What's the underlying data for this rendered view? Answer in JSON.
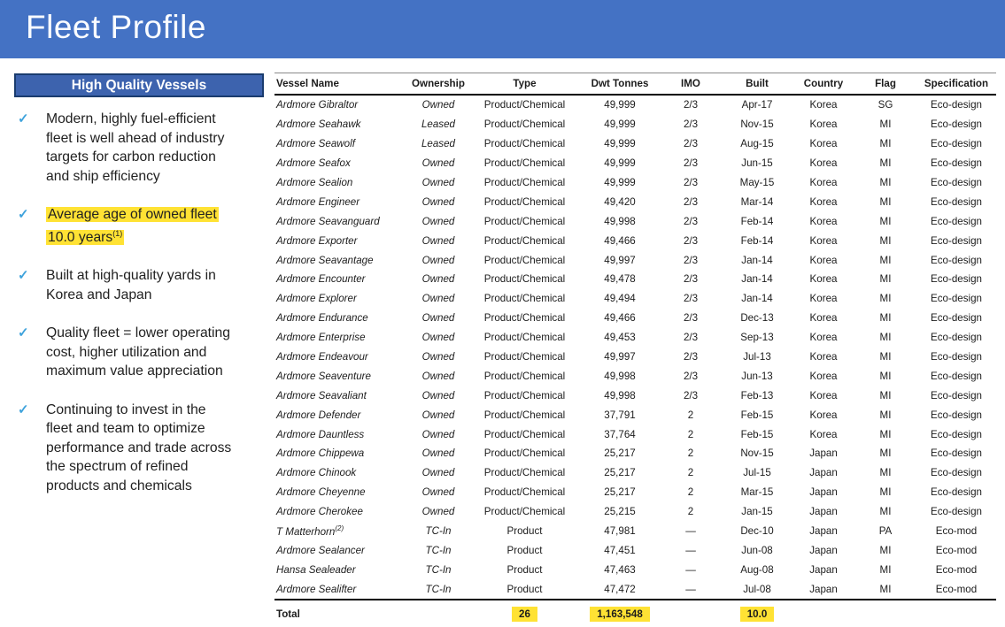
{
  "slide": {
    "title": "Fleet Profile"
  },
  "colors": {
    "title_bar_blue": "#4472C4",
    "panel_blue": "#3D63AE",
    "panel_border_navy": "#1A3C6E",
    "check_blue": "#3FA3DC",
    "highlight_yellow": "#FFE234"
  },
  "sidebar": {
    "header": "High Quality Vessels",
    "check_icon": "✓",
    "bullets": [
      {
        "lines": [
          "Modern, highly fuel-efficient",
          "fleet is well ahead of industry",
          "targets for carbon reduction",
          "and ship efficiency"
        ],
        "highlight": false,
        "sup": ""
      },
      {
        "lines": [
          "Average age of owned fleet",
          "10.0 years"
        ],
        "highlight": true,
        "sup": "(1)"
      },
      {
        "lines": [
          "Built at high-quality yards in",
          "Korea and Japan"
        ],
        "highlight": false,
        "sup": ""
      },
      {
        "lines": [
          "Quality fleet = lower operating",
          "cost, higher utilization and",
          "maximum value appreciation"
        ],
        "highlight": false,
        "sup": ""
      },
      {
        "lines": [
          "Continuing to invest in the",
          "fleet and team to optimize",
          "performance and trade across",
          "the spectrum of refined",
          "products and chemicals"
        ],
        "highlight": false,
        "sup": ""
      }
    ]
  },
  "table": {
    "columns": [
      "Vessel Name",
      "Ownership",
      "Type",
      "Dwt Tonnes",
      "IMO",
      "Built",
      "Country",
      "Flag",
      "Specification"
    ],
    "rows": [
      {
        "name": "Ardmore Gibraltor",
        "sup": "",
        "ownership": "Owned",
        "type": "Product/Chemical",
        "dwt": "49,999",
        "imo": "2/3",
        "built": "Apr-17",
        "country": "Korea",
        "flag": "SG",
        "spec": "Eco-design"
      },
      {
        "name": "Ardmore Seahawk",
        "sup": "",
        "ownership": "Leased",
        "type": "Product/Chemical",
        "dwt": "49,999",
        "imo": "2/3",
        "built": "Nov-15",
        "country": "Korea",
        "flag": "MI",
        "spec": "Eco-design"
      },
      {
        "name": "Ardmore Seawolf",
        "sup": "",
        "ownership": "Leased",
        "type": "Product/Chemical",
        "dwt": "49,999",
        "imo": "2/3",
        "built": "Aug-15",
        "country": "Korea",
        "flag": "MI",
        "spec": "Eco-design"
      },
      {
        "name": "Ardmore Seafox",
        "sup": "",
        "ownership": "Owned",
        "type": "Product/Chemical",
        "dwt": "49,999",
        "imo": "2/3",
        "built": "Jun-15",
        "country": "Korea",
        "flag": "MI",
        "spec": "Eco-design"
      },
      {
        "name": "Ardmore Sealion",
        "sup": "",
        "ownership": "Owned",
        "type": "Product/Chemical",
        "dwt": "49,999",
        "imo": "2/3",
        "built": "May-15",
        "country": "Korea",
        "flag": "MI",
        "spec": "Eco-design"
      },
      {
        "name": "Ardmore Engineer",
        "sup": "",
        "ownership": "Owned",
        "type": "Product/Chemical",
        "dwt": "49,420",
        "imo": "2/3",
        "built": "Mar-14",
        "country": "Korea",
        "flag": "MI",
        "spec": "Eco-design"
      },
      {
        "name": "Ardmore Seavanguard",
        "sup": "",
        "ownership": "Owned",
        "type": "Product/Chemical",
        "dwt": "49,998",
        "imo": "2/3",
        "built": "Feb-14",
        "country": "Korea",
        "flag": "MI",
        "spec": "Eco-design"
      },
      {
        "name": "Ardmore Exporter",
        "sup": "",
        "ownership": "Owned",
        "type": "Product/Chemical",
        "dwt": "49,466",
        "imo": "2/3",
        "built": "Feb-14",
        "country": "Korea",
        "flag": "MI",
        "spec": "Eco-design"
      },
      {
        "name": "Ardmore Seavantage",
        "sup": "",
        "ownership": "Owned",
        "type": "Product/Chemical",
        "dwt": "49,997",
        "imo": "2/3",
        "built": "Jan-14",
        "country": "Korea",
        "flag": "MI",
        "spec": "Eco-design"
      },
      {
        "name": "Ardmore Encounter",
        "sup": "",
        "ownership": "Owned",
        "type": "Product/Chemical",
        "dwt": "49,478",
        "imo": "2/3",
        "built": "Jan-14",
        "country": "Korea",
        "flag": "MI",
        "spec": "Eco-design"
      },
      {
        "name": "Ardmore Explorer",
        "sup": "",
        "ownership": "Owned",
        "type": "Product/Chemical",
        "dwt": "49,494",
        "imo": "2/3",
        "built": "Jan-14",
        "country": "Korea",
        "flag": "MI",
        "spec": "Eco-design"
      },
      {
        "name": "Ardmore Endurance",
        "sup": "",
        "ownership": "Owned",
        "type": "Product/Chemical",
        "dwt": "49,466",
        "imo": "2/3",
        "built": "Dec-13",
        "country": "Korea",
        "flag": "MI",
        "spec": "Eco-design"
      },
      {
        "name": "Ardmore Enterprise",
        "sup": "",
        "ownership": "Owned",
        "type": "Product/Chemical",
        "dwt": "49,453",
        "imo": "2/3",
        "built": "Sep-13",
        "country": "Korea",
        "flag": "MI",
        "spec": "Eco-design"
      },
      {
        "name": "Ardmore Endeavour",
        "sup": "",
        "ownership": "Owned",
        "type": "Product/Chemical",
        "dwt": "49,997",
        "imo": "2/3",
        "built": "Jul-13",
        "country": "Korea",
        "flag": "MI",
        "spec": "Eco-design"
      },
      {
        "name": "Ardmore Seaventure",
        "sup": "",
        "ownership": "Owned",
        "type": "Product/Chemical",
        "dwt": "49,998",
        "imo": "2/3",
        "built": "Jun-13",
        "country": "Korea",
        "flag": "MI",
        "spec": "Eco-design"
      },
      {
        "name": "Ardmore Seavaliant",
        "sup": "",
        "ownership": "Owned",
        "type": "Product/Chemical",
        "dwt": "49,998",
        "imo": "2/3",
        "built": "Feb-13",
        "country": "Korea",
        "flag": "MI",
        "spec": "Eco-design"
      },
      {
        "name": "Ardmore Defender",
        "sup": "",
        "ownership": "Owned",
        "type": "Product/Chemical",
        "dwt": "37,791",
        "imo": "2",
        "built": "Feb-15",
        "country": "Korea",
        "flag": "MI",
        "spec": "Eco-design"
      },
      {
        "name": "Ardmore Dauntless",
        "sup": "",
        "ownership": "Owned",
        "type": "Product/Chemical",
        "dwt": "37,764",
        "imo": "2",
        "built": "Feb-15",
        "country": "Korea",
        "flag": "MI",
        "spec": "Eco-design"
      },
      {
        "name": "Ardmore Chippewa",
        "sup": "",
        "ownership": "Owned",
        "type": "Product/Chemical",
        "dwt": "25,217",
        "imo": "2",
        "built": "Nov-15",
        "country": "Japan",
        "flag": "MI",
        "spec": "Eco-design"
      },
      {
        "name": "Ardmore Chinook",
        "sup": "",
        "ownership": "Owned",
        "type": "Product/Chemical",
        "dwt": "25,217",
        "imo": "2",
        "built": "Jul-15",
        "country": "Japan",
        "flag": "MI",
        "spec": "Eco-design"
      },
      {
        "name": "Ardmore Cheyenne",
        "sup": "",
        "ownership": "Owned",
        "type": "Product/Chemical",
        "dwt": "25,217",
        "imo": "2",
        "built": "Mar-15",
        "country": "Japan",
        "flag": "MI",
        "spec": "Eco-design"
      },
      {
        "name": "Ardmore Cherokee",
        "sup": "",
        "ownership": "Owned",
        "type": "Product/Chemical",
        "dwt": "25,215",
        "imo": "2",
        "built": "Jan-15",
        "country": "Japan",
        "flag": "MI",
        "spec": "Eco-design"
      },
      {
        "name": "T Matterhorn",
        "sup": "(2)",
        "ownership": "TC-In",
        "type": "Product",
        "dwt": "47,981",
        "imo": "—",
        "built": "Dec-10",
        "country": "Japan",
        "flag": "PA",
        "spec": "Eco-mod"
      },
      {
        "name": "Ardmore Sealancer",
        "sup": "",
        "ownership": "TC-In",
        "type": "Product",
        "dwt": "47,451",
        "imo": "—",
        "built": "Jun-08",
        "country": "Japan",
        "flag": "MI",
        "spec": "Eco-mod"
      },
      {
        "name": "Hansa Sealeader",
        "sup": "",
        "ownership": "TC-In",
        "type": "Product",
        "dwt": "47,463",
        "imo": "—",
        "built": "Aug-08",
        "country": "Japan",
        "flag": "MI",
        "spec": "Eco-mod"
      },
      {
        "name": "Ardmore Sealifter",
        "sup": "",
        "ownership": "TC-In",
        "type": "Product",
        "dwt": "47,472",
        "imo": "—",
        "built": "Jul-08",
        "country": "Japan",
        "flag": "MI",
        "spec": "Eco-mod"
      }
    ],
    "total": {
      "label": "Total",
      "vessel_count": "26",
      "dwt_total": "1,163,548",
      "avg_age": "10.0"
    }
  }
}
